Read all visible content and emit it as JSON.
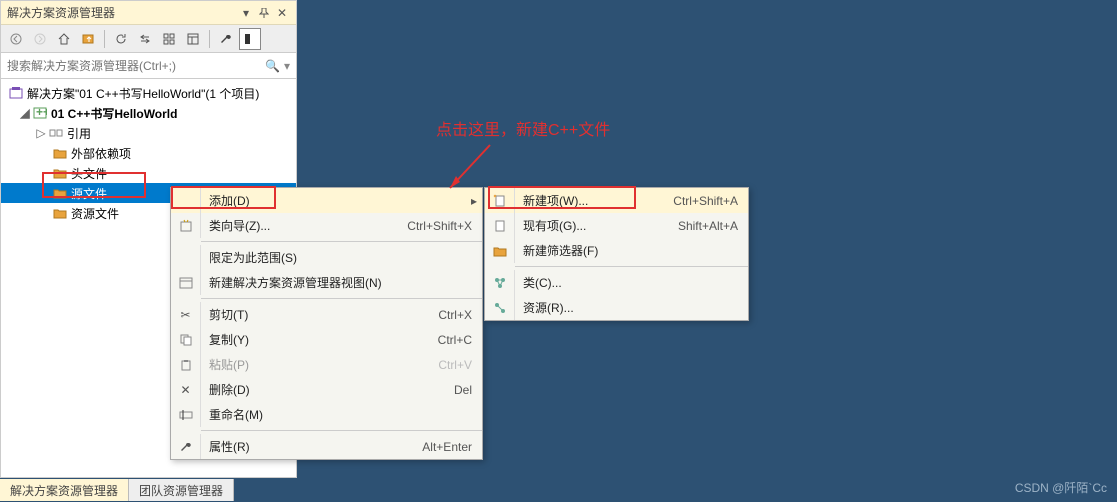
{
  "panel": {
    "title": "解决方案资源管理器",
    "search_placeholder": "搜索解决方案资源管理器(Ctrl+;)"
  },
  "tree": {
    "solution": "解决方案\"01 C++书写HelloWorld\"(1 个项目)",
    "project": "01 C++书写HelloWorld",
    "refs": "引用",
    "external": "外部依赖项",
    "headers": "头文件",
    "sources": "源文件",
    "resources": "资源文件"
  },
  "menu1": {
    "add": "添加(D)",
    "wizard": "类向导(Z)...",
    "wizard_sc": "Ctrl+Shift+X",
    "scope": "限定为此范围(S)",
    "newview": "新建解决方案资源管理器视图(N)",
    "cut": "剪切(T)",
    "cut_sc": "Ctrl+X",
    "copy": "复制(Y)",
    "copy_sc": "Ctrl+C",
    "paste": "粘贴(P)",
    "paste_sc": "Ctrl+V",
    "delete": "删除(D)",
    "delete_sc": "Del",
    "rename": "重命名(M)",
    "props": "属性(R)",
    "props_sc": "Alt+Enter"
  },
  "menu2": {
    "newitem": "新建项(W)...",
    "newitem_sc": "Ctrl+Shift+A",
    "existing": "现有项(G)...",
    "existing_sc": "Shift+Alt+A",
    "newfilter": "新建筛选器(F)",
    "class": "类(C)...",
    "resource": "资源(R)..."
  },
  "tabs": {
    "t1": "解决方案资源管理器",
    "t2": "团队资源管理器"
  },
  "annotation": "点击这里，新建C++文件",
  "watermark": "CSDN @阡陌`Cc"
}
